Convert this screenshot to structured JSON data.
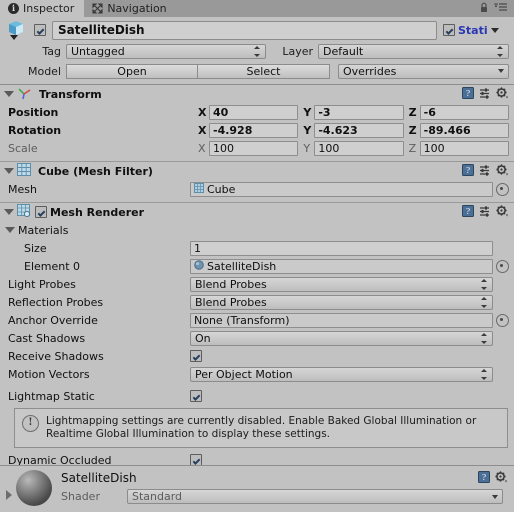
{
  "window": {
    "tabs": [
      {
        "label": "Inspector",
        "icon": "info-icon",
        "active": true
      },
      {
        "label": "Navigation",
        "icon": "navigation-icon",
        "active": false
      }
    ],
    "lock_icon": "lock-icon",
    "menu_icon": "hamburger-menu-icon"
  },
  "gameobject": {
    "icon": "prefab-cube-icon",
    "enabled": true,
    "name": "SatelliteDish",
    "static_label": "Stati",
    "static_checked": true,
    "tag_label": "Tag",
    "tag_value": "Untagged",
    "layer_label": "Layer",
    "layer_value": "Default",
    "model_label": "Model",
    "open_button": "Open",
    "select_button": "Select",
    "overrides_button": "Overrides"
  },
  "transform": {
    "title": "Transform",
    "icon": "transform-axis-icon",
    "rows": [
      {
        "label": "Position",
        "bold": true,
        "x": "40",
        "y": "-3",
        "z": "-6"
      },
      {
        "label": "Rotation",
        "bold": true,
        "x": "-4.928",
        "y": "-4.623",
        "z": "-89.466"
      },
      {
        "label": "Scale",
        "bold": false,
        "x": "100",
        "y": "100",
        "z": "100"
      }
    ],
    "axis_labels": {
      "x": "X",
      "y": "Y",
      "z": "Z"
    }
  },
  "mesh_filter": {
    "title": "Cube (Mesh Filter)",
    "icon": "mesh-filter-icon",
    "mesh_label": "Mesh",
    "mesh_value": "Cube"
  },
  "mesh_renderer": {
    "title": "Mesh Renderer",
    "icon": "mesh-renderer-icon",
    "enabled": true,
    "materials_label": "Materials",
    "size_label": "Size",
    "size_value": "1",
    "element_label": "Element 0",
    "element_value": "SatelliteDish",
    "light_probes_label": "Light Probes",
    "light_probes_value": "Blend Probes",
    "reflection_probes_label": "Reflection Probes",
    "reflection_probes_value": "Blend Probes",
    "anchor_override_label": "Anchor Override",
    "anchor_override_value": "None (Transform)",
    "cast_shadows_label": "Cast Shadows",
    "cast_shadows_value": "On",
    "receive_shadows_label": "Receive Shadows",
    "receive_shadows_checked": true,
    "motion_vectors_label": "Motion Vectors",
    "motion_vectors_value": "Per Object Motion",
    "lightmap_static_label": "Lightmap Static",
    "lightmap_static_checked": true,
    "help_text": "Lightmapping settings are currently disabled. Enable Baked Global Illumination or Realtime Global Illumination to display these settings.",
    "dynamic_occluded_label": "Dynamic Occluded",
    "dynamic_occluded_checked": true
  },
  "material_preview": {
    "name": "SatelliteDish",
    "shader_label": "Shader",
    "shader_value": "Standard",
    "preview_icon": "material-sphere-preview"
  },
  "icons": {
    "help": "help-book-icon",
    "preset": "preset-sliders-icon",
    "settings": "gear-icon"
  },
  "colors": {
    "background": "#c2c2c2",
    "tabbar": "#999999",
    "static_blue": "#2a37b4",
    "field": "#cfcfcf",
    "border": "#8e8e8e"
  }
}
